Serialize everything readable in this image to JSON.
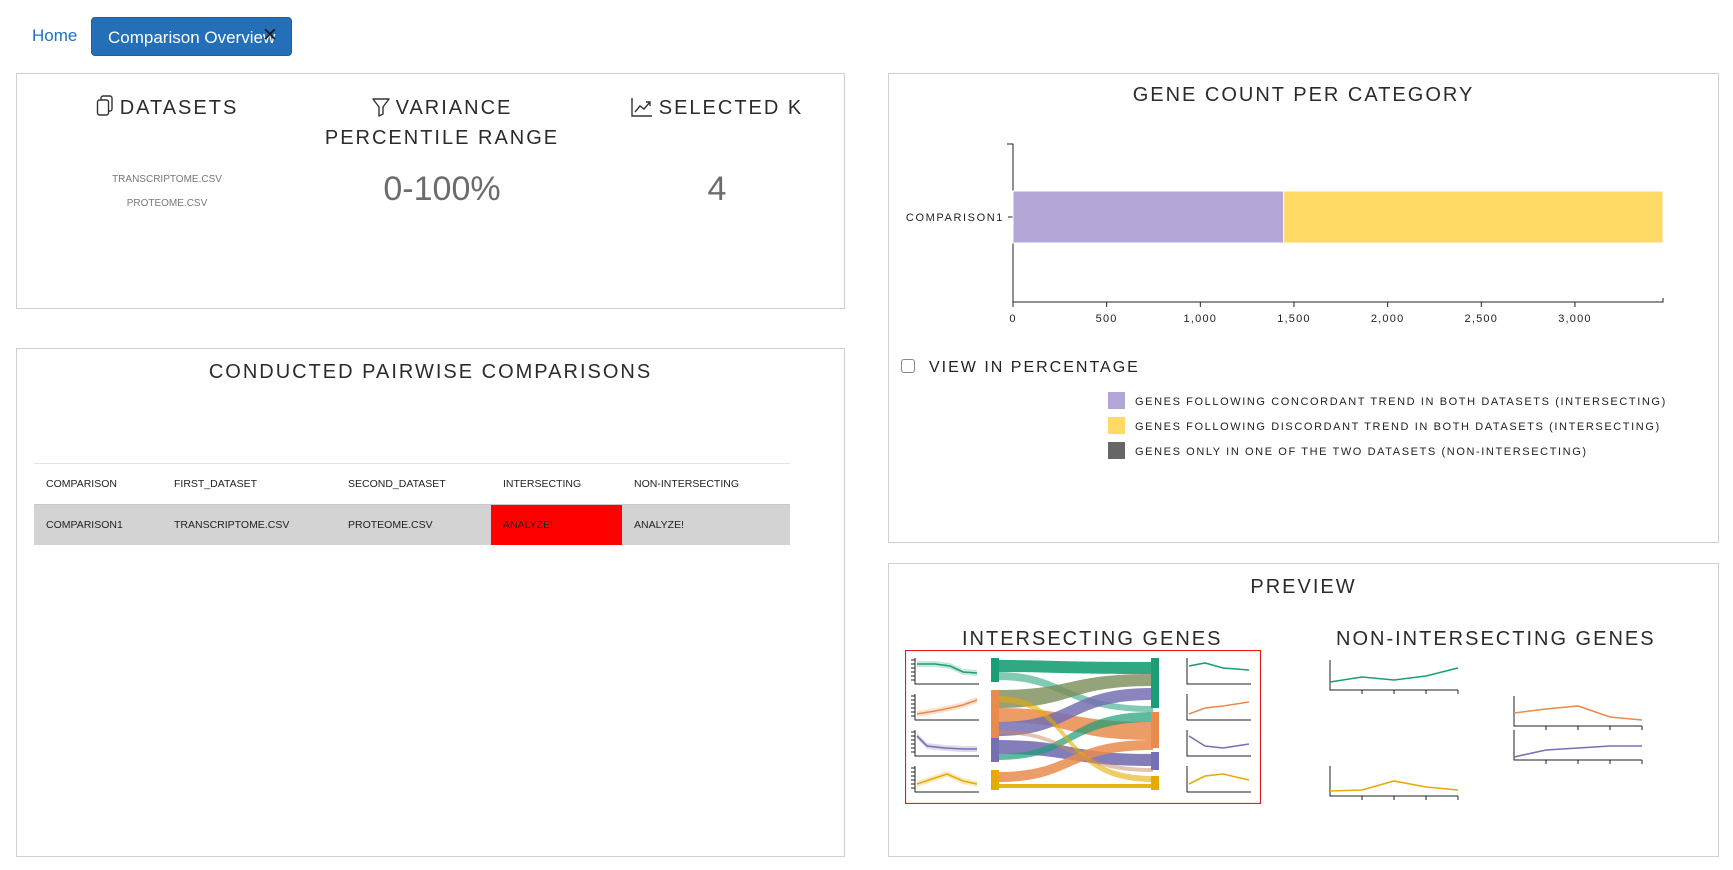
{
  "tabs": {
    "home": "Home",
    "active": "Comparison Overview",
    "close_glyph": "✕"
  },
  "stats": {
    "datasets": {
      "label": "DATASETS",
      "icon": "copy-icon",
      "items": [
        "TRANSCRIPTOME.CSV",
        "PROTEOME.CSV"
      ]
    },
    "variance": {
      "label_line1": "VARIANCE",
      "label_line2": "PERCENTILE RANGE",
      "icon": "filter-icon",
      "value": "0-100%"
    },
    "selected_k": {
      "label": "SELECTED K",
      "icon": "chart-line-icon",
      "value": "4"
    }
  },
  "comparisons": {
    "title": "CONDUCTED PAIRWISE COMPARISONS",
    "columns": [
      "COMPARISON",
      "FIRST_DATASET",
      "SECOND_DATASET",
      "INTERSECTING",
      "NON-INTERSECTING"
    ],
    "rows": [
      {
        "comparison": "COMPARISON1",
        "first": "TRANSCRIPTOME.CSV",
        "second": "PROTEOME.CSV",
        "intersecting": "ANALYZE!",
        "non_intersecting": "ANALYZE!"
      }
    ]
  },
  "gene_chart": {
    "title": "GENE COUNT PER CATEGORY",
    "checkbox_label": "VIEW IN PERCENTAGE",
    "legend": [
      {
        "label": "GENES FOLLOWING CONCORDANT TREND IN BOTH DATASETS (INTERSECTING)",
        "color": "#b3a6d6"
      },
      {
        "label": "GENES FOLLOWING DISCORDANT TREND IN BOTH DATASETS (INTERSECTING)",
        "color": "#ffd966"
      },
      {
        "label": "GENES ONLY IN ONE OF THE TWO DATASETS (NON-INTERSECTING)",
        "color": "#666666"
      }
    ]
  },
  "chart_data": {
    "type": "bar",
    "orientation": "horizontal",
    "stacked": true,
    "categories": [
      "COMPARISON1"
    ],
    "series": [
      {
        "name": "GENES FOLLOWING CONCORDANT TREND IN BOTH DATASETS (INTERSECTING)",
        "values": [
          1445
        ],
        "color": "#b3a6d6"
      },
      {
        "name": "GENES FOLLOWING DISCORDANT TREND IN BOTH DATASETS (INTERSECTING)",
        "values": [
          2025
        ],
        "color": "#ffd966"
      },
      {
        "name": "GENES ONLY IN ONE OF THE TWO DATASETS (NON-INTERSECTING)",
        "values": [
          0
        ],
        "color": "#666666"
      }
    ],
    "xlim": [
      0,
      3470
    ],
    "xticks": [
      0,
      500,
      1000,
      1500,
      2000,
      2500,
      3000
    ],
    "xtick_labels": [
      "0",
      "500",
      "1,000",
      "1,500",
      "2,000",
      "2,500",
      "3,000"
    ],
    "legend_position": "bottom-right",
    "grid": false
  },
  "preview": {
    "title": "PREVIEW",
    "intersecting_title": "INTERSECTING GENES",
    "non_intersecting_title": "NON-INTERSECTING GENES",
    "cluster_colors": [
      "#1b9e77",
      "#e98b4c",
      "#7570b3",
      "#e6ab02"
    ]
  }
}
